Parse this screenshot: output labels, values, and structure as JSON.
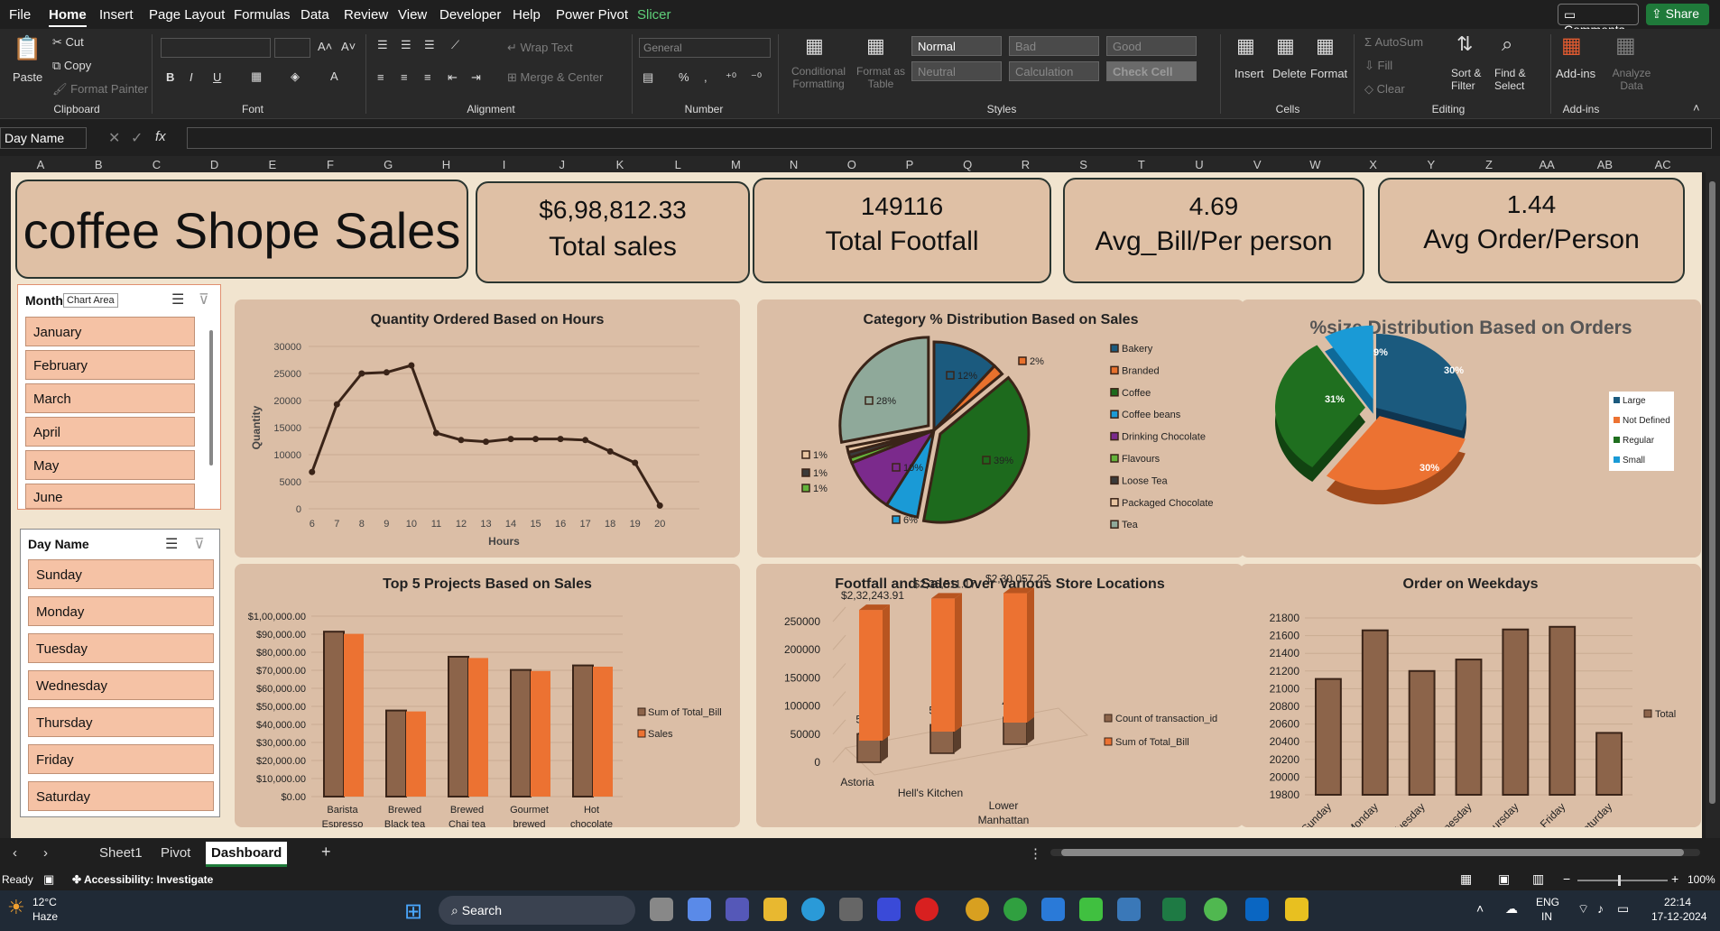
{
  "menu": {
    "items": [
      "File",
      "Home",
      "Insert",
      "Page Layout",
      "Formulas",
      "Data",
      "Review",
      "View",
      "Developer",
      "Help",
      "Power Pivot",
      "Slicer"
    ],
    "comments": "Comments",
    "share": "Share"
  },
  "ribbon": {
    "clipboard": {
      "paste": "Paste",
      "cut": "Cut",
      "copy": "Copy",
      "format_painter": "Format Painter",
      "label": "Clipboard"
    },
    "font": {
      "label": "Font"
    },
    "alignment": {
      "wrap_text": "Wrap Text",
      "merge": "Merge & Center",
      "label": "Alignment"
    },
    "number": {
      "format": "General",
      "label": "Number"
    },
    "styles": {
      "conditional": "Conditional Formatting",
      "format_table": "Format as Table",
      "normal": "Normal",
      "bad": "Bad",
      "good": "Good",
      "neutral": "Neutral",
      "calculation": "Calculation",
      "check_cell": "Check Cell",
      "label": "Styles"
    },
    "cells": {
      "insert": "Insert",
      "delete": "Delete",
      "format": "Format",
      "label": "Cells"
    },
    "editing": {
      "autosum": "AutoSum",
      "fill": "Fill",
      "clear": "Clear",
      "sort": "Sort & Filter",
      "find": "Find & Select",
      "label": "Editing"
    },
    "addins": {
      "addins": "Add-ins",
      "analyze": "Analyze Data",
      "label": "Add-ins"
    }
  },
  "formula": {
    "namebox": "Day Name",
    "fx": "fx"
  },
  "columns": [
    "A",
    "B",
    "C",
    "D",
    "E",
    "F",
    "G",
    "H",
    "I",
    "J",
    "K",
    "L",
    "M",
    "N",
    "O",
    "P",
    "Q",
    "R",
    "S",
    "T",
    "U",
    "V",
    "W",
    "X",
    "Y",
    "Z",
    "AA",
    "AB",
    "AC"
  ],
  "kpis": {
    "title": "coffee Shope Sales",
    "total_sales_value": "$6,98,812.33",
    "total_sales_label": "Total sales",
    "footfall_value": "149116",
    "footfall_label": "Total Footfall",
    "avg_bill_value": "4.69",
    "avg_bill_label": "Avg_Bill/Per person",
    "avg_order_value": "1.44",
    "avg_order_label": "Avg Order/Person"
  },
  "slicers": {
    "month": {
      "title": "Month",
      "tooltip": "Chart Area",
      "items": [
        "January",
        "February",
        "March",
        "April",
        "May",
        "June"
      ]
    },
    "day": {
      "title": "Day Name",
      "items": [
        "Sunday",
        "Monday",
        "Tuesday",
        "Wednesday",
        "Thursday",
        "Friday",
        "Saturday"
      ]
    }
  },
  "chart_data": [
    {
      "id": "hours",
      "type": "line",
      "title": "Quantity Ordered Based on Hours",
      "xlabel": "Hours",
      "ylabel": "Quantity",
      "x": [
        6,
        7,
        8,
        9,
        10,
        11,
        12,
        13,
        14,
        15,
        16,
        17,
        18,
        19,
        20
      ],
      "values": [
        6800,
        19300,
        25000,
        25200,
        26500,
        14000,
        12700,
        12400,
        12900,
        12900,
        12900,
        12700,
        10600,
        8500,
        600
      ],
      "ylim": [
        0,
        30000
      ],
      "yticks": [
        0,
        5000,
        10000,
        15000,
        20000,
        25000,
        30000
      ]
    },
    {
      "id": "category",
      "type": "pie",
      "title": "Category % Distribution Based on  Sales",
      "categories": [
        "Bakery",
        "Branded",
        "Coffee",
        "Coffee beans",
        "Drinking Chocolate",
        "Flavours",
        "Loose Tea",
        "Packaged Chocolate",
        "Tea"
      ],
      "values": [
        12,
        2,
        39,
        6,
        10,
        1,
        1,
        1,
        28
      ],
      "labels": [
        "12%",
        "2%",
        "39%",
        "6%",
        "10%",
        "1%",
        "1%",
        "1%",
        "28%"
      ],
      "colors": [
        "#1b5a7e",
        "#e8712d",
        "#1d6a1d",
        "#1a9ad6",
        "#7b2a8c",
        "#64b33b",
        "#3a3a3a",
        "#e8c4a0",
        "#8fa99a"
      ]
    },
    {
      "id": "size",
      "type": "pie",
      "title": "%size Distribution Based on Orders",
      "categories": [
        "Large",
        "Not Defined",
        "Regular",
        "Small"
      ],
      "values": [
        30,
        30,
        31,
        9
      ],
      "labels": [
        "30%",
        "30%",
        "31%",
        "9%"
      ],
      "colors": [
        "#1b5a7e",
        "#ec7232",
        "#1f6f1f",
        "#1a9ad6"
      ]
    },
    {
      "id": "products",
      "type": "bar",
      "title": "Top 5 Projects Based on Sales",
      "categories": [
        "Barista Espresso",
        "Brewed Black tea",
        "Brewed Chai tea",
        "Gourmet brewed coffee",
        "Hot chocolate"
      ],
      "series": [
        {
          "name": "Sum of Total_Bill",
          "values": [
            91400,
            47700,
            77500,
            70200,
            72700
          ]
        },
        {
          "name": "Sales",
          "values": [
            90200,
            47200,
            76800,
            69600,
            72000
          ]
        }
      ],
      "ylim": [
        0,
        100000
      ],
      "yticks": [
        "$0.00",
        "$10,000.00",
        "$20,000.00",
        "$30,000.00",
        "$40,000.00",
        "$50,000.00",
        "$60,000.00",
        "$70,000.00",
        "$80,000.00",
        "$90,000.00",
        "$1,00,000.00"
      ],
      "colors": [
        "#8c644a",
        "#ec7232"
      ]
    },
    {
      "id": "locations",
      "type": "bar",
      "title": "Footfall and Sales Over Various Store Locations",
      "categories": [
        "Astoria",
        "Hell's Kitchen",
        "Lower Manhattan"
      ],
      "series": [
        {
          "name": "Count of transaction_id",
          "values": [
            50599,
            50735,
            47782
          ],
          "labels": [
            "50599",
            "50735",
            "47782"
          ]
        },
        {
          "name": "Sum of Total_Bill",
          "values": [
            232243.91,
            236511.17,
            230057.25
          ],
          "labels": [
            "$2,32,243.91",
            "$2,36,511.17",
            "$2,30,057.25"
          ]
        }
      ],
      "ylim": [
        0,
        250000
      ],
      "yticks": [
        "0",
        "50000",
        "100000",
        "150000",
        "200000",
        "250000"
      ],
      "colors": [
        "#8c644a",
        "#ec7232"
      ]
    },
    {
      "id": "weekdays",
      "type": "bar",
      "title": "Order on Weekdays",
      "categories": [
        "Sunday",
        "Monday",
        "Tuesday",
        "Wednesday",
        "Thursday",
        "Friday",
        "Saturday"
      ],
      "series": [
        {
          "name": "Total",
          "values": [
            21110,
            21660,
            21200,
            21330,
            21670,
            21700,
            20500
          ]
        }
      ],
      "ylim": [
        19800,
        21800
      ],
      "yticks": [
        "19800",
        "20000",
        "20200",
        "20400",
        "20600",
        "20800",
        "21000",
        "21200",
        "21400",
        "21600",
        "21800"
      ],
      "colors": [
        "#8c644a"
      ]
    }
  ],
  "sheets": {
    "tabs": [
      "Sheet1",
      "Pivot",
      "Dashboard"
    ],
    "active": "Dashboard"
  },
  "status": {
    "ready": "Ready",
    "accessibility": "Accessibility: Investigate",
    "zoom": "100%"
  },
  "taskbar": {
    "temp": "12°C",
    "weather": "Haze",
    "search": "Search",
    "lang1": "ENG",
    "lang2": "IN",
    "time": "22:14",
    "date": "17-12-2024"
  }
}
